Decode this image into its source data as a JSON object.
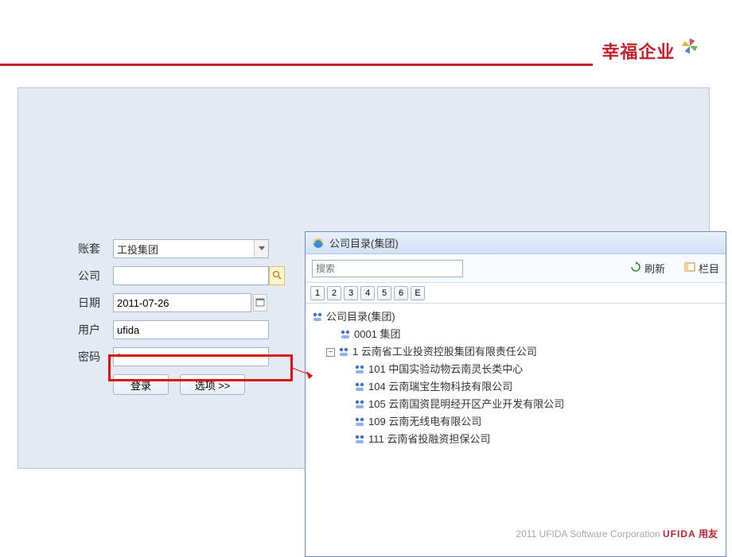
{
  "brand": {
    "text": "幸福企业"
  },
  "login": {
    "labels": {
      "account_set": "账套",
      "company": "公司",
      "date": "日期",
      "user": "用户",
      "password": "密码"
    },
    "values": {
      "account_set": "工投集团",
      "company": "",
      "date": "2011-07-26",
      "user": "ufida",
      "password": "*"
    },
    "buttons": {
      "login": "登录",
      "options": "选项 >>"
    }
  },
  "directory": {
    "title": "公司目录(集团)",
    "search_placeholder": "搜索",
    "toolbar": {
      "refresh": "刷新",
      "columns": "栏目"
    },
    "levels": [
      "1",
      "2",
      "3",
      "4",
      "5",
      "6",
      "E"
    ],
    "tree": {
      "root": "公司目录(集团)",
      "items": [
        {
          "label": "0001 集团"
        },
        {
          "label": "1 云南省工业投资控股集团有限责任公司",
          "children": [
            "101 中国实验动物云南灵长类中心",
            "104 云南瑞宝生物科技有限公司",
            "105 云南国资昆明经开区产业开发有限公司",
            "109 云南无线电有限公司",
            "111 云南省投融资担保公司"
          ]
        }
      ]
    }
  },
  "footer": {
    "copyright": "2011 UFIDA Software Corporation",
    "logo1": "UFIDA",
    "logo2": "用友"
  }
}
